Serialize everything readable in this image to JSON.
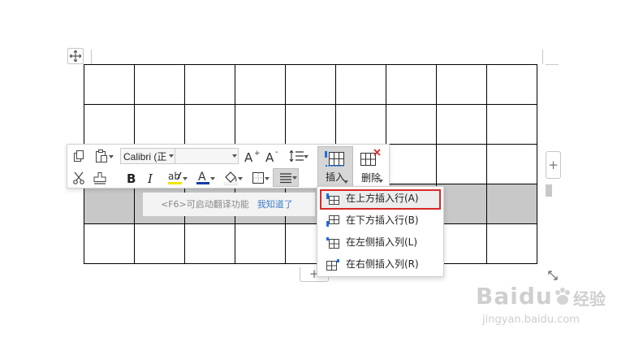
{
  "toolbar": {
    "font_name": "Calibri (正",
    "font_size": "",
    "insert_label": "插入",
    "delete_label": "删除",
    "icons": [
      "copy-icon",
      "paste-icon",
      "cut-icon",
      "format-painter-icon",
      "grow-font-icon",
      "shrink-font-icon",
      "line-spacing-icon",
      "bold-icon",
      "italic-icon",
      "highlight-icon",
      "font-color-icon",
      "shading-icon",
      "borders-icon",
      "align-icon",
      "insert-table-icon",
      "delete-table-icon"
    ],
    "colors": {
      "highlight": "#f5e400",
      "font_color": "#1a3aa8",
      "active_bg": "#d6d6d6"
    }
  },
  "tooltip": {
    "hint": "<F6>可启动翻译功能",
    "dismiss": "我知道了"
  },
  "insert_menu": {
    "items": [
      {
        "label": "在上方插入行(A)",
        "highlighted": true
      },
      {
        "label": "在下方插入行(B)",
        "highlighted": false
      },
      {
        "label": "在左侧插入列(L)",
        "highlighted": false
      },
      {
        "label": "在右侧插入列(R)",
        "highlighted": false
      }
    ],
    "highlight_color": "#d9282a"
  },
  "table": {
    "rows": 5,
    "cols": 9,
    "selected_row": 4
  },
  "side_controls": {
    "add_symbol": "+"
  },
  "watermark": {
    "brand": "Baidu",
    "sub": "经验",
    "url": "jingyan.baidu.com"
  }
}
